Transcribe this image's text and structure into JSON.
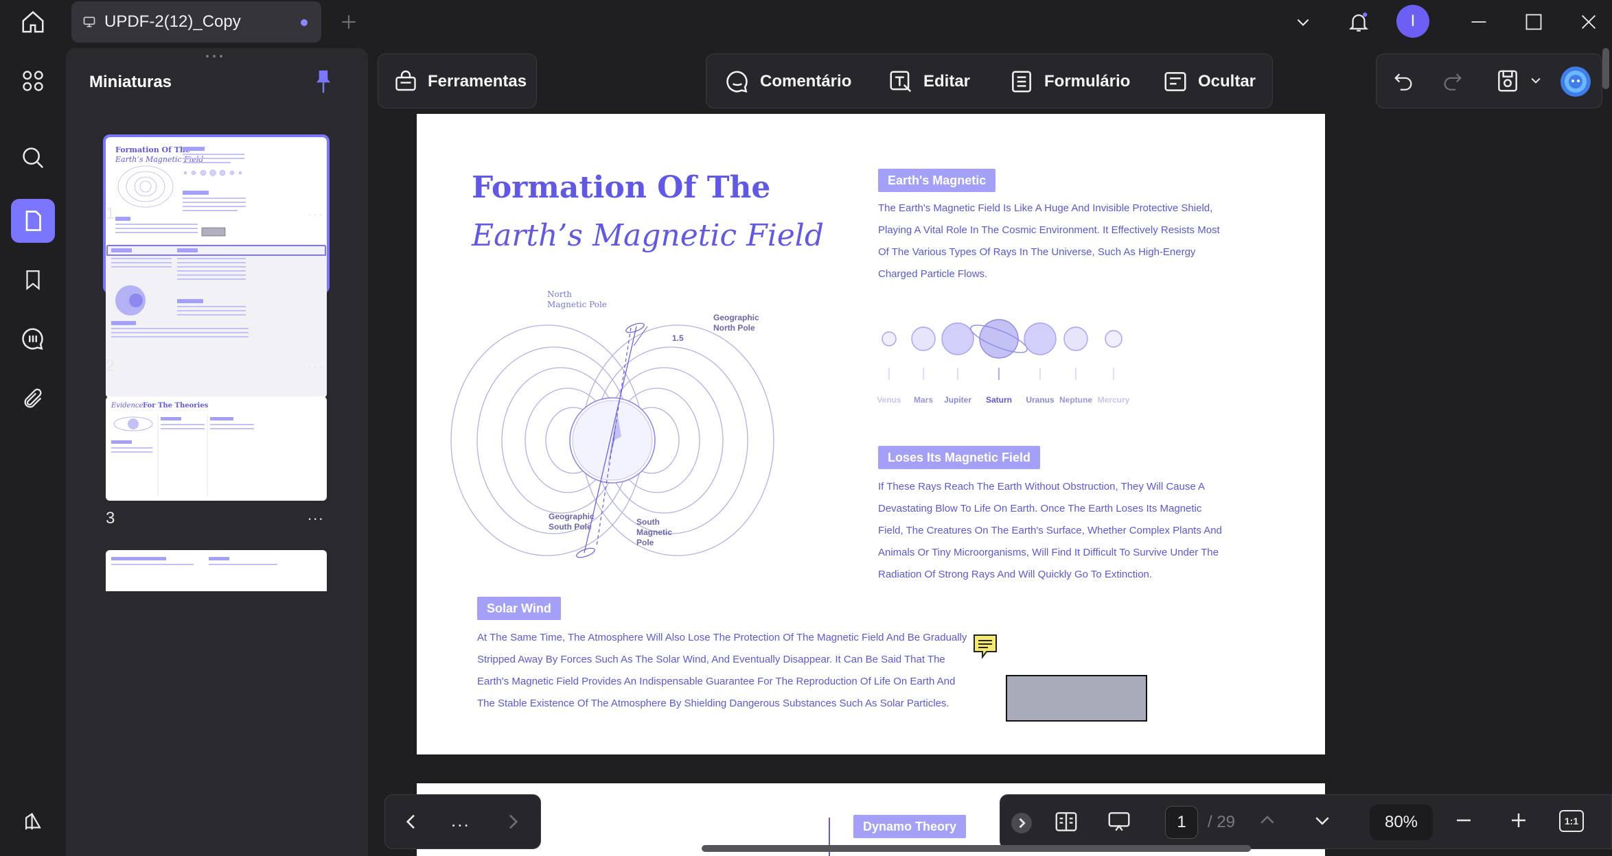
{
  "titlebar": {
    "tab_title": "UPDF-2(12)_Copy",
    "avatar_letter": "I",
    "accent": "#7b76ff"
  },
  "panel": {
    "title": "Miniaturas",
    "thumbnails": [
      {
        "page": "1",
        "more": "..."
      },
      {
        "page": "2",
        "more": "..."
      },
      {
        "page": "3",
        "more": "..."
      }
    ]
  },
  "toolbar": {
    "tools_label": "Ferramentas",
    "comment_label": "Comentário",
    "edit_label": "Editar",
    "form_label": "Formulário",
    "hide_label": "Ocultar"
  },
  "page1": {
    "title_line1": "Formation Of The",
    "title_line2": "Earth’s Magnetic Field",
    "diagram_labels": {
      "north_magnetic_pole": "North Magnetic Pole",
      "geographic_north_pole": "Geographic North Pole",
      "angle": "1.5",
      "geographic_south_pole": "Geographic South Pole",
      "south_magnetic_pole": "South Magnetic Pole"
    },
    "section1": {
      "label": "Earth's Magnetic",
      "lines": [
        "The Earth's Magnetic Field Is Like A Huge And Invisible Protective Shield,",
        "Playing A Vital Role In The Cosmic Environment. It Effectively Resists Most",
        "Of The Various Types Of Rays In The Universe, Such As High-Energy",
        "Charged Particle Flows."
      ]
    },
    "planets": [
      "Venus",
      "Mars",
      "Jupiter",
      "Saturn",
      "Uranus",
      "Neptune",
      "Mercury"
    ],
    "section2": {
      "label": "Loses Its Magnetic Field",
      "lines": [
        "If These Rays Reach The Earth Without Obstruction, They Will Cause A",
        "Devastating Blow To Life On Earth. Once The Earth Loses Its Magnetic",
        "Field, The Creatures On The Earth's Surface, Whether Complex Plants And",
        "Animals Or Tiny Microorganisms, Will Find It Difficult To Survive Under The",
        "Radiation Of Strong Rays And Will Quickly Go To Extinction."
      ]
    },
    "section3": {
      "label": "Solar Wind",
      "lines": [
        "At The Same Time, The Atmosphere Will Also Lose The Protection Of The Magnetic Field And Be Gradually",
        "Stripped Away By Forces Such As The Solar Wind, And Eventually Disappear. It Can Be Said That The",
        "Earth's Magnetic Field Provides An Indispensable Guarantee For The Reproduction Of Life On Earth And",
        "The Stable Existence Of The Atmosphere By Shielding Dangerous Substances Such As Solar Particles."
      ]
    }
  },
  "page2": {
    "label": "Dynamo Theory"
  },
  "nav": {
    "more": "...",
    "current_page": "1",
    "total_pages": "/ 29",
    "zoom": "80%",
    "fit_label": "1:1"
  }
}
